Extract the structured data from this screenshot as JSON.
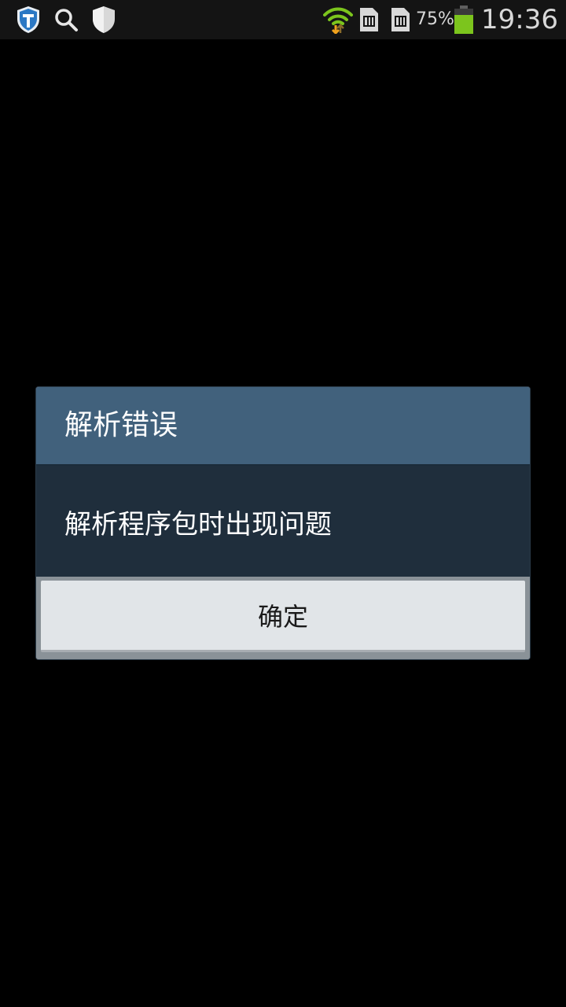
{
  "status_bar": {
    "icons": [
      "shield-t-icon",
      "search-icon",
      "shield-icon",
      "wifi-icon",
      "sim1-icon",
      "sim2-icon",
      "battery-icon"
    ],
    "battery_percent": "75%",
    "battery_level": 0.75,
    "time": "19:36"
  },
  "dialog": {
    "title": "解析错误",
    "message": "解析程序包时出现问题",
    "ok_label": "确定"
  },
  "colors": {
    "background": "#000000",
    "status_bar_bg": "#141414",
    "dialog_header_bg": "#41617c",
    "dialog_body_bg": "#1f2e3c",
    "button_bg": "#e1e5e8",
    "battery_fill": "#7cc51d",
    "wifi_arrow": "#f1a21d"
  }
}
